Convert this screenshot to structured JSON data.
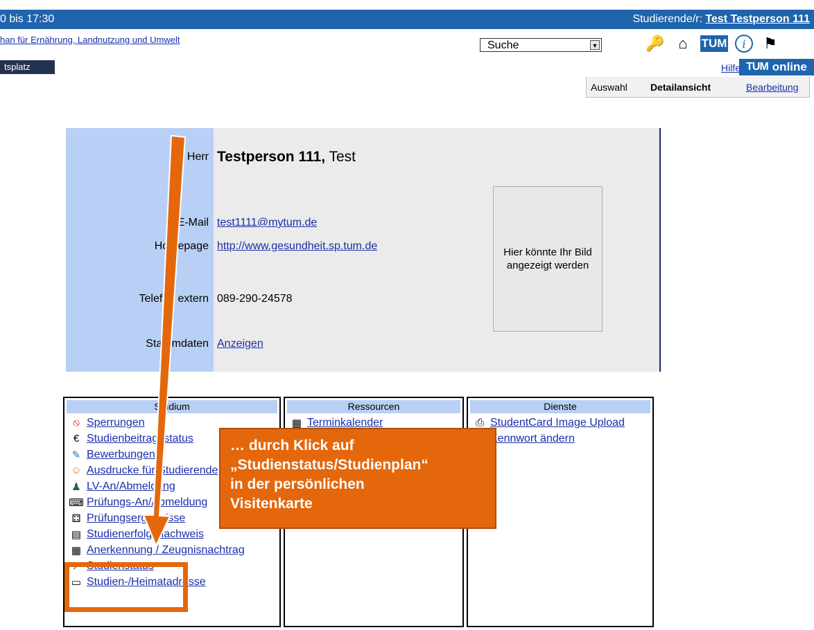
{
  "topbar": {
    "time": "0 bis 17:30",
    "user_label": "Studierende/r:",
    "user_name": "Test Testperson 111"
  },
  "facility": "han für Ernährung, Landnutzung und Umwelt",
  "search": {
    "selected": "Suche"
  },
  "icons": [
    "key-icon",
    "home-icon",
    "tum-logo-icon",
    "info-icon",
    "language-flag-icon"
  ],
  "workspace_label": "tsplatz",
  "help_link": "Hilfe",
  "tumonline": {
    "logo": "TUM",
    "text": "online"
  },
  "modes": {
    "auswahl": "Auswahl",
    "detail": "Detailansicht",
    "edit": "Bearbeitung"
  },
  "card": {
    "salutation": "Herr",
    "last_name": "Testperson 111,",
    "first_name": "Test",
    "email_label": "E-Mail",
    "email": "test1111@mytum.de",
    "homepage_label": "Homepage",
    "homepage": "http://www.gesundheit.sp.tum.de",
    "phone_label": "Telefon extern",
    "phone": "089-290-24578",
    "stammdaten_label": "Stammdaten",
    "stammdaten_link": "Anzeigen",
    "photo_placeholder": "Hier könnte Ihr Bild angezeigt werden"
  },
  "boxes": {
    "studium": {
      "title": "Studium",
      "items": [
        {
          "label": "Sperrungen",
          "icon": "🚫"
        },
        {
          "label": "Studienbeitragsstatus",
          "icon": "€"
        },
        {
          "label": "Bewerbungen",
          "icon": "✎"
        },
        {
          "label": "Ausdrucke für Studierende",
          "icon": "👥"
        },
        {
          "label": "LV-An/Abmeldung",
          "icon": "👪"
        },
        {
          "label": "Prüfungs-An/Abmeldung",
          "icon": "🖶"
        },
        {
          "label": "Prüfungsergebnisse",
          "icon": "⁂"
        },
        {
          "label": "Studienerfolgsnachweis",
          "icon": "▤"
        },
        {
          "label": "Anerkennung / Zeugnisnachtrag",
          "icon": "▦"
        },
        {
          "label": "Studienstatus",
          "icon": "🗲"
        },
        {
          "label": "Studien-/Heimatadresse",
          "icon": "▭"
        }
      ]
    },
    "ressourcen": {
      "title": "Ressourcen",
      "items": [
        {
          "label": "Terminkalender",
          "icon": "▦"
        }
      ]
    },
    "dienste": {
      "title": "Dienste",
      "items": [
        {
          "label": "StudentCard Image Upload",
          "icon": "📷"
        },
        {
          "label": "Kennwort ändern",
          "icon": "🔑"
        }
      ]
    }
  },
  "callout": {
    "line1": "… durch Klick auf",
    "line2": "„Studienstatus/Studienplan“",
    "line3": "in der persönlichen",
    "line4": "Visitenkarte"
  },
  "colors": {
    "header_blue": "#1f64ac",
    "card_side": "#b8d0f5",
    "callout_orange": "#e4670c"
  }
}
